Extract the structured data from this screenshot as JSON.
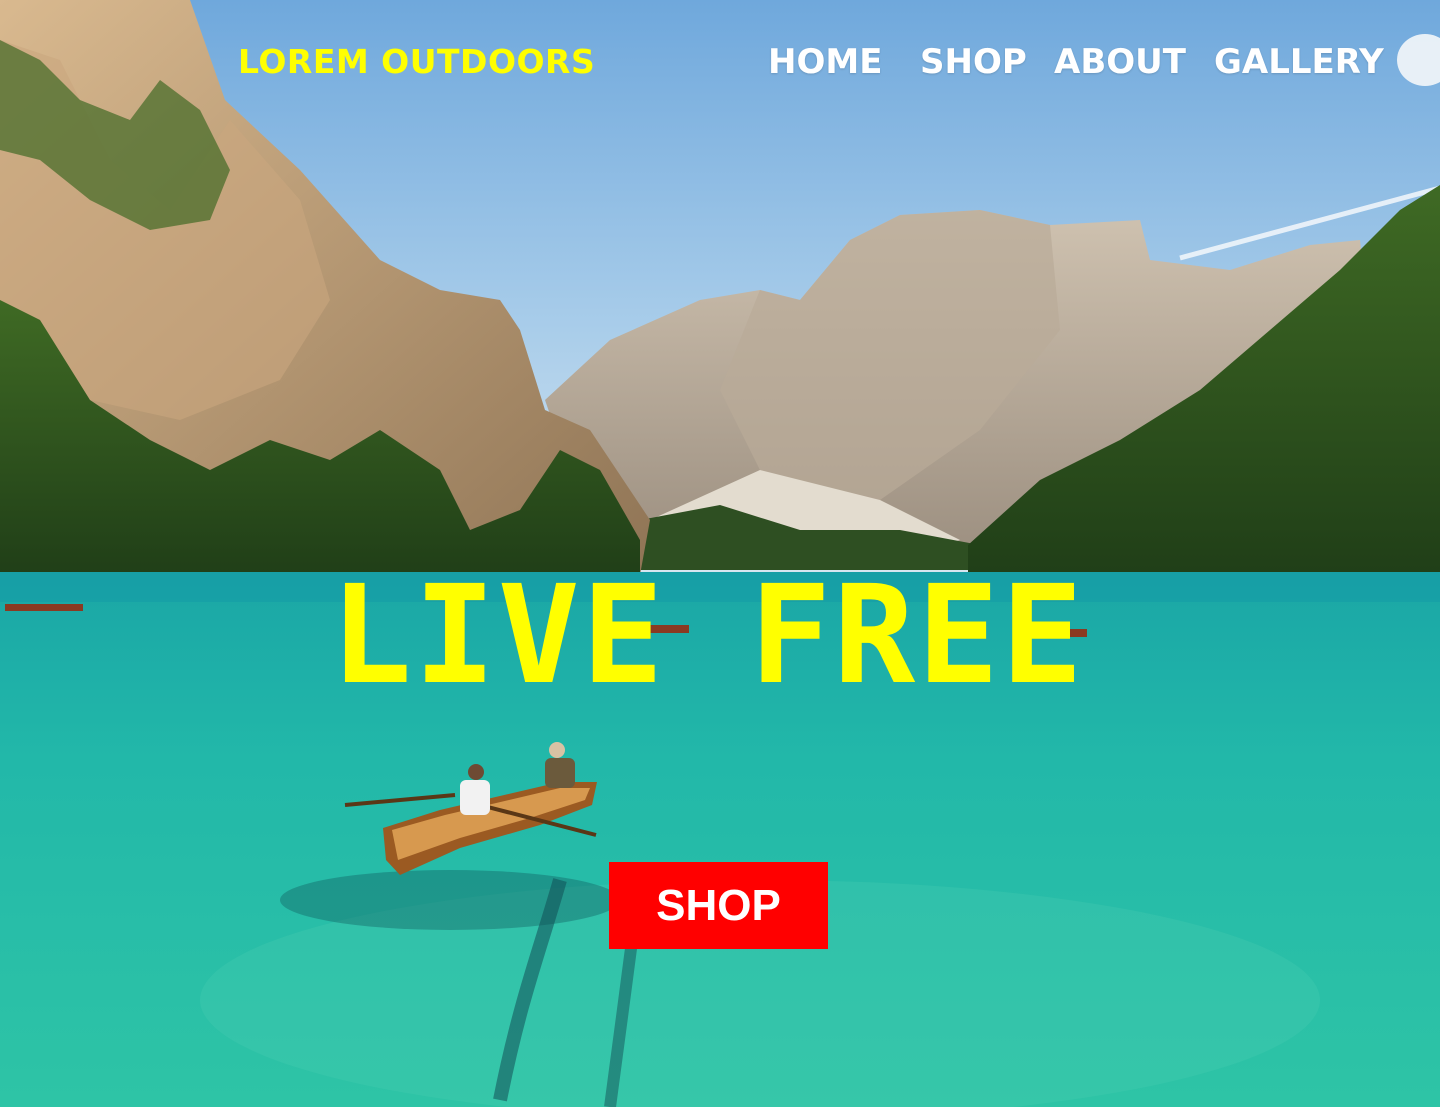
{
  "header": {
    "brand": "LOREM OUTDOORS",
    "nav": [
      {
        "label": "HOME"
      },
      {
        "label": "SHOP"
      },
      {
        "label": "ABOUT"
      },
      {
        "label": "GALLERY"
      }
    ]
  },
  "hero": {
    "headline": "LIVE FREE",
    "cta_label": "SHOP",
    "background": "mountain-lake-rowboat-photo"
  },
  "colors": {
    "brand": "#ffff00",
    "headline": "#ffff00",
    "nav_text": "#ffffff",
    "cta_background": "#ff0000",
    "cta_text": "#ffffff",
    "sky": "#8fbde6",
    "lake": "#1fb8a8"
  }
}
